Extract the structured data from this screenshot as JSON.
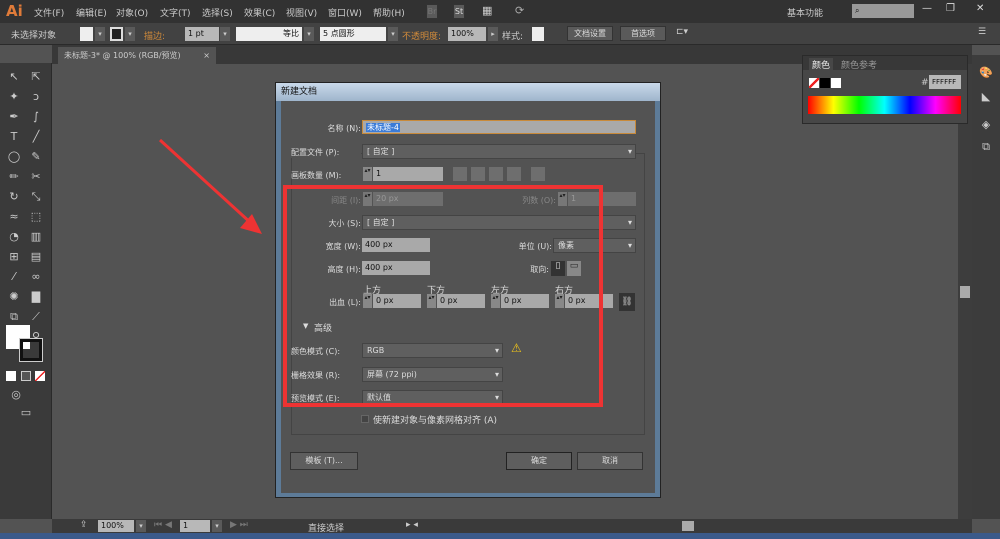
{
  "app": {
    "logo": "Ai",
    "menus": [
      "文件(F)",
      "编辑(E)",
      "对象(O)",
      "文字(T)",
      "选择(S)",
      "效果(C)",
      "视图(V)",
      "窗口(W)",
      "帮助(H)"
    ],
    "workspace": "基本功能",
    "br_label": "Br",
    "st_label": "St"
  },
  "control": {
    "selection": "未选择对象",
    "stroke_label": "描边:",
    "stroke_value": "1 pt",
    "stroke_profile": "等比",
    "brush": "5 点圆形",
    "opacity_label": "不透明度:",
    "opacity": "100%",
    "style_label": "样式:",
    "doc_setup": "文档设置",
    "prefs": "首选项"
  },
  "doc_tab": {
    "title": "未标题-3* @ 100% (RGB/预览)",
    "close": "×"
  },
  "color_panel": {
    "tabs": [
      "颜色",
      "颜色参考"
    ],
    "hex_prefix": "#",
    "hex": "FFFFFF"
  },
  "status": {
    "zoom": "100%",
    "page": "1",
    "tool": "直接选择"
  },
  "dialog": {
    "title": "新建文档",
    "name_label": "名称 (N):",
    "name_value": "未标题-4",
    "profile_label": "配置文件 (P):",
    "profile_value": "[ 自定 ]",
    "artboards_label": "画板数量 (M):",
    "artboards_value": "1",
    "spacing_label": "间距 (I):",
    "spacing_value": "20 px",
    "columns_label": "列数 (O):",
    "columns_value": "1",
    "size_label": "大小 (S):",
    "size_value": "[ 自定 ]",
    "width_label": "宽度 (W):",
    "width_value": "400 px",
    "units_label": "单位 (U):",
    "units_value": "像素",
    "height_label": "高度 (H):",
    "height_value": "400 px",
    "orientation_label": "取向:",
    "bleed_label": "出血 (L):",
    "bleed": [
      {
        "label": "上方",
        "value": "0 px"
      },
      {
        "label": "下方",
        "value": "0 px"
      },
      {
        "label": "左方",
        "value": "0 px"
      },
      {
        "label": "右方",
        "value": "0 px"
      }
    ],
    "advanced_label": "高级",
    "color_mode_label": "颜色模式 (C):",
    "color_mode_value": "RGB",
    "raster_label": "栅格效果 (R):",
    "raster_value": "屏幕 (72 ppi)",
    "preview_label": "预览模式 (E):",
    "preview_value": "默认值",
    "align_label": "使新建对象与像素网格对齐 (A)",
    "align_checked": false,
    "template_btn": "模板 (T)...",
    "ok_btn": "确定",
    "cancel_btn": "取消"
  },
  "annotation": {
    "highlight_color": "#ee3333"
  }
}
